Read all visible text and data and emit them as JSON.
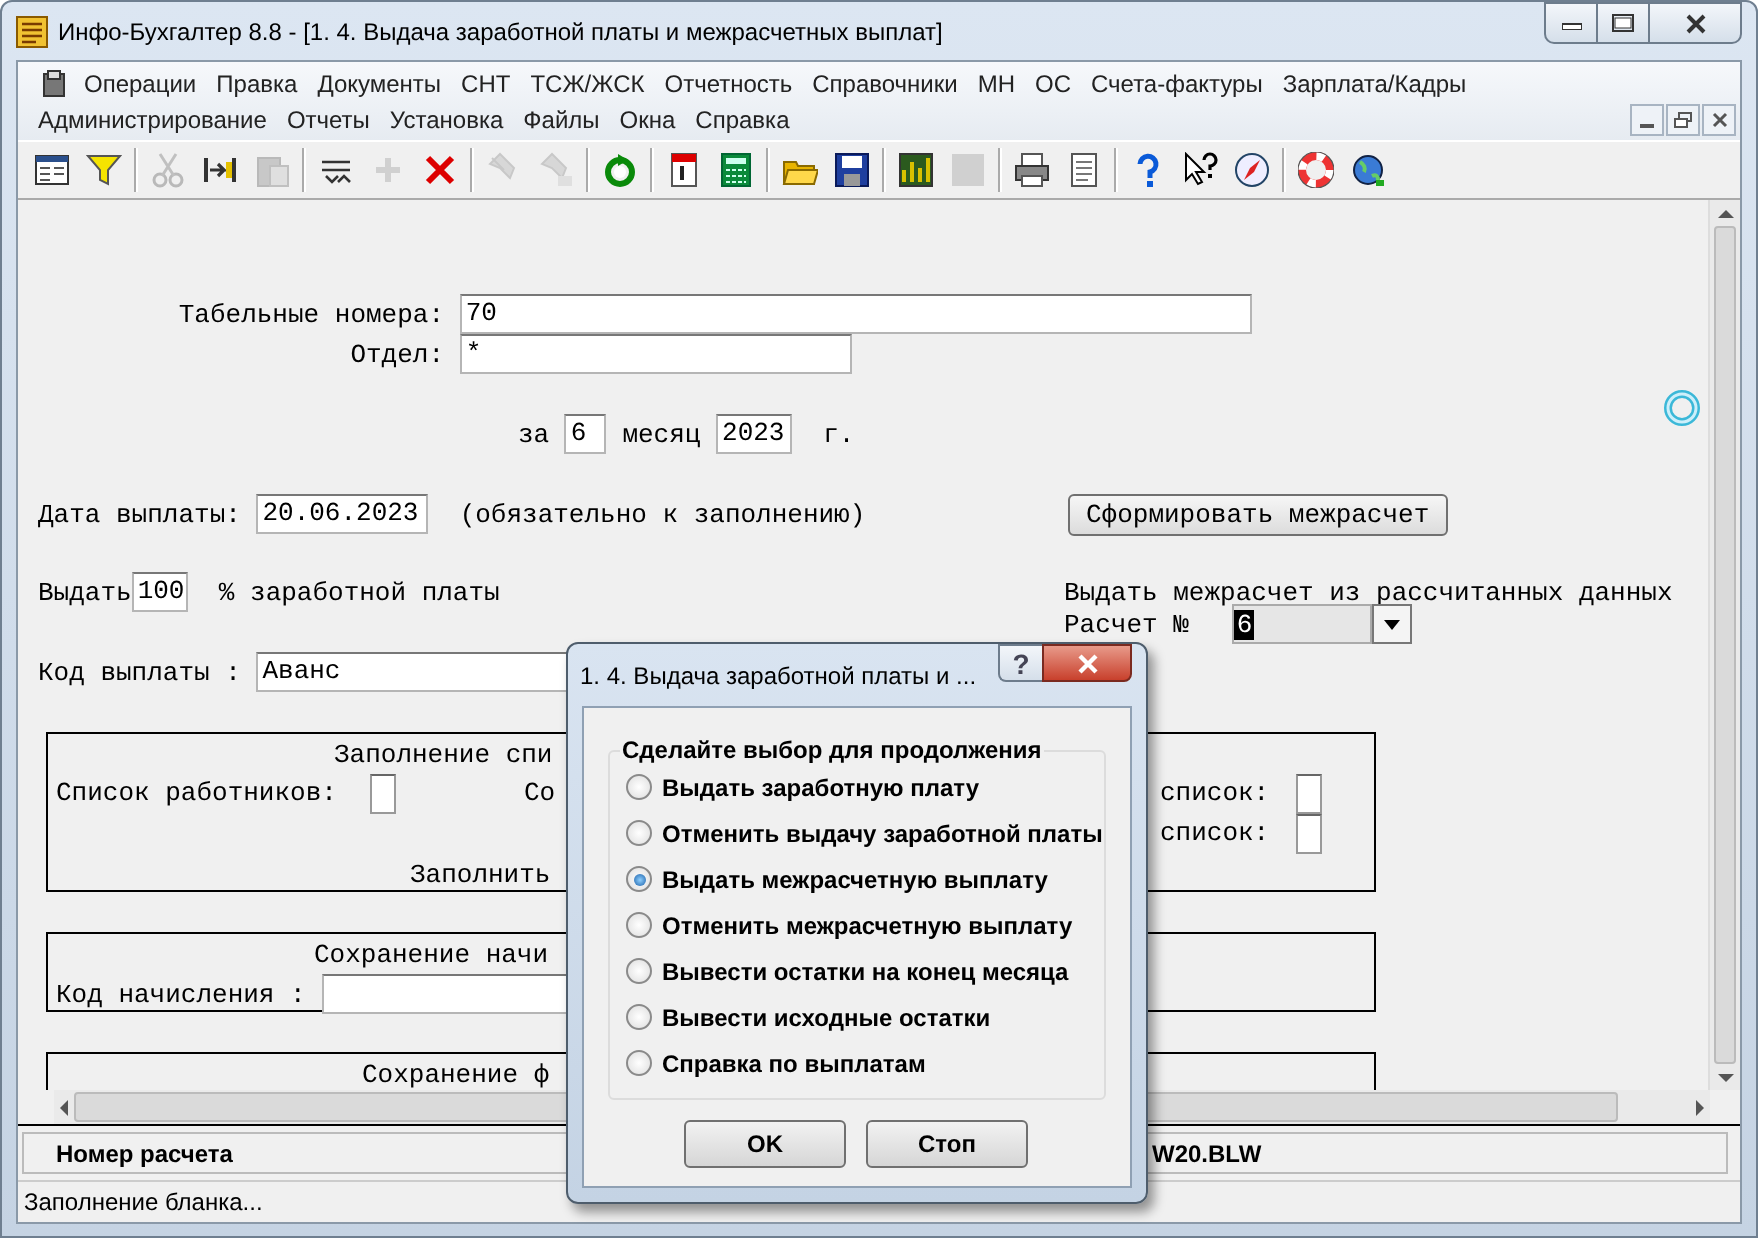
{
  "window": {
    "title": "Инфо-Бухгалтер 8.8 - [1. 4. Выдача заработной платы и межрасчетных выплат]"
  },
  "menu_rows": [
    [
      "Операции",
      "Правка",
      "Документы",
      "СНТ",
      "ТСЖ/ЖСК",
      "Отчетность",
      "Справочники",
      "МН",
      "ОС",
      "Счета-фактуры",
      "Зарплата/Кадры"
    ],
    [
      "Администрирование",
      "Отчеты",
      "Установка",
      "Файлы",
      "Окна",
      "Справка"
    ]
  ],
  "toolbar": [
    [
      {
        "kind": "form",
        "disabled": false
      },
      {
        "kind": "filter",
        "disabled": false
      }
    ],
    [
      {
        "kind": "cut",
        "disabled": true
      },
      {
        "kind": "move",
        "disabled": false
      },
      {
        "kind": "paste",
        "disabled": true
      }
    ],
    [
      {
        "kind": "sort",
        "disabled": false
      },
      {
        "kind": "add",
        "disabled": true
      },
      {
        "kind": "delete",
        "disabled": false
      }
    ],
    [
      {
        "kind": "find",
        "disabled": true
      },
      {
        "kind": "find_replace",
        "disabled": true
      }
    ],
    [
      {
        "kind": "refresh",
        "disabled": false
      }
    ],
    [
      {
        "kind": "calendar",
        "disabled": false
      },
      {
        "kind": "calculator",
        "disabled": false
      }
    ],
    [
      {
        "kind": "open",
        "disabled": false
      },
      {
        "kind": "save",
        "disabled": false
      }
    ],
    [
      {
        "kind": "chart",
        "disabled": false
      },
      {
        "kind": "blank",
        "disabled": true
      }
    ],
    [
      {
        "kind": "print",
        "disabled": false
      },
      {
        "kind": "document",
        "disabled": false
      }
    ],
    [
      {
        "kind": "help",
        "disabled": false
      },
      {
        "kind": "context_help",
        "disabled": false
      },
      {
        "kind": "compass",
        "disabled": false
      }
    ],
    [
      {
        "kind": "lifebuoy",
        "disabled": false
      },
      {
        "kind": "globe",
        "disabled": false
      }
    ]
  ],
  "form": {
    "tab_numbers": {
      "label": "Табельные номера:",
      "value": "70"
    },
    "department": {
      "label": "Отдел:",
      "value": "*"
    },
    "period": {
      "prefix": "за",
      "month": "6",
      "month_label": "месяц",
      "year": "2023",
      "suffix": "г."
    },
    "payment_date": {
      "label": "Дата выплаты:",
      "value": "20.06.2023",
      "note": "(обязательно к заполнению)"
    },
    "build_button": "Сформировать межрасчет",
    "percent": {
      "prefix": "Выдать",
      "value": "100",
      "suffix": "% заработной платы"
    },
    "interim_caption": "Выдать межрасчет из рассчитанных данных",
    "calc_number": {
      "label": "Расчет №",
      "value": "6"
    },
    "payment_code": {
      "label": "Код выплаты :",
      "value": "Аванс"
    },
    "fill_group": {
      "title": "Заполнение спи",
      "employees_label": "Список работников:",
      "employees_checked": false,
      "col_label": "Со",
      "list_rows": [
        {
          "label": "список:",
          "checked": false
        },
        {
          "label": "список:",
          "checked": false
        }
      ],
      "fill_label": "Заполнить"
    },
    "accrual_group": {
      "title": "Сохранение начи",
      "code_label": "Код начисления :"
    },
    "fund_group": {
      "title": "Сохранение ф"
    }
  },
  "status": {
    "panel_label": "Номер расчета",
    "panel_value": "W20.BLW",
    "message": "Заполнение бланка..."
  },
  "dialog": {
    "title": "1. 4. Выдача заработной платы и ...",
    "help_button": "?",
    "group_caption": "Сделайте выбор для продолжения",
    "options": [
      {
        "label": "Выдать заработную плату",
        "selected": false
      },
      {
        "label": "Отменить выдачу заработной платы",
        "selected": false
      },
      {
        "label": "Выдать межрасчетную выплату",
        "selected": true
      },
      {
        "label": "Отменить межрасчетную выплату",
        "selected": false
      },
      {
        "label": "Вывести остатки на конец месяца",
        "selected": false
      },
      {
        "label": "Вывести исходные остатки",
        "selected": false
      },
      {
        "label": "Справка по выплатам",
        "selected": false
      }
    ],
    "buttons": [
      "OK",
      "Стоп"
    ]
  }
}
